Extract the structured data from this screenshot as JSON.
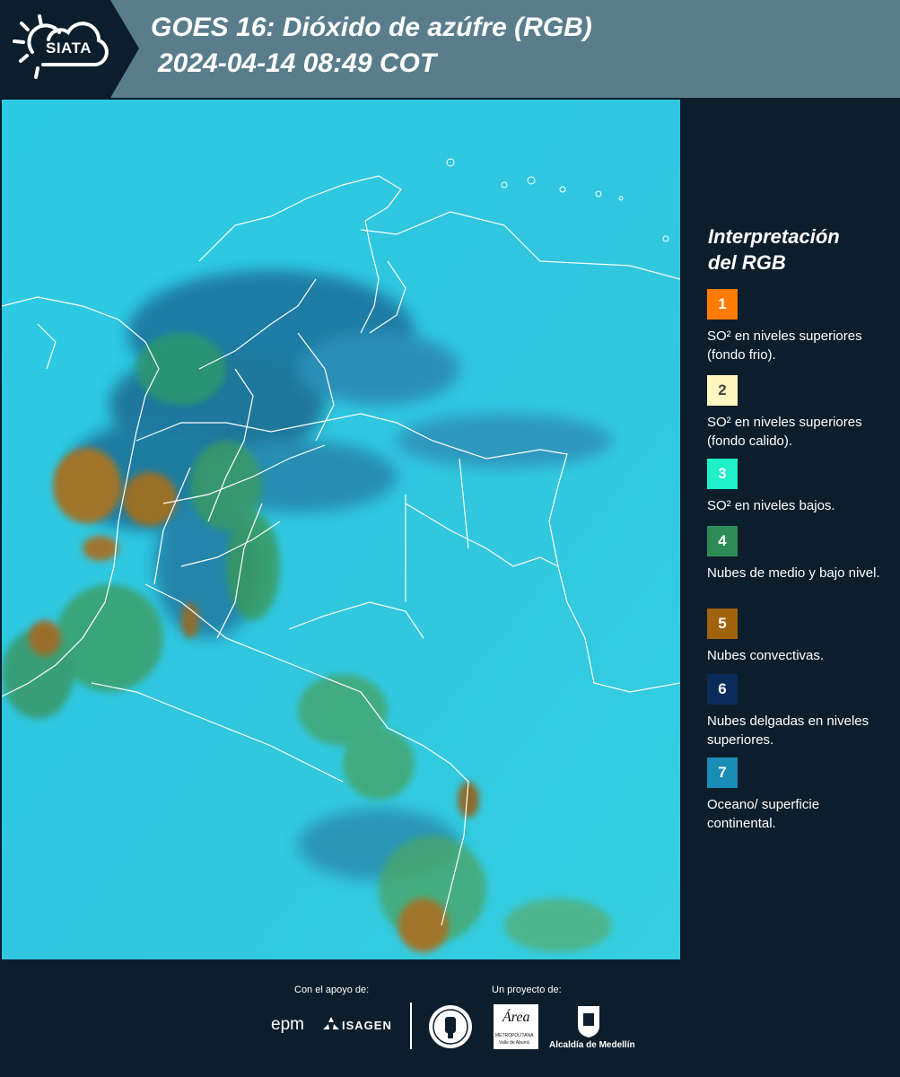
{
  "header": {
    "logo_text": "SIATA",
    "title_line1": "GOES 16: Dióxido de azúfre (RGB)",
    "title_line2": "2024-04-14 08:49 COT",
    "accent_color": "#5a7d8c"
  },
  "legend": {
    "title_line1": "Interpretación",
    "title_line2": "del RGB",
    "items": [
      {
        "number": "1",
        "color": "#ff7a00",
        "text": "SO² en niveles superiores (fondo frio)."
      },
      {
        "number": "2",
        "color": "#fff7c0",
        "text": "SO² en niveles superiores (fondo calido)."
      },
      {
        "number": "3",
        "color": "#1ef0c8",
        "text": "SO² en niveles bajos."
      },
      {
        "number": "4",
        "color": "#2e8b57",
        "text": "Nubes de medio y bajo nivel."
      },
      {
        "number": "5",
        "color": "#a0620a",
        "text": "Nubes convectivas."
      },
      {
        "number": "6",
        "color": "#0a2a5a",
        "text": "Nubes delgadas en niveles superiores."
      },
      {
        "number": "7",
        "color": "#1a8cb8",
        "text": "Oceano/ superficie continental."
      }
    ]
  },
  "footer": {
    "support_label": "Con el apoyo de:",
    "project_label": "Un proyecto de:",
    "sponsors": {
      "epm": "epm",
      "isagen": "ISAGEN",
      "area_name": "Área",
      "area_sub": "METROPOLITANA",
      "area_sub2": "Valle de Aburrá",
      "alcaldia": "Alcaldía de Medellín"
    }
  }
}
